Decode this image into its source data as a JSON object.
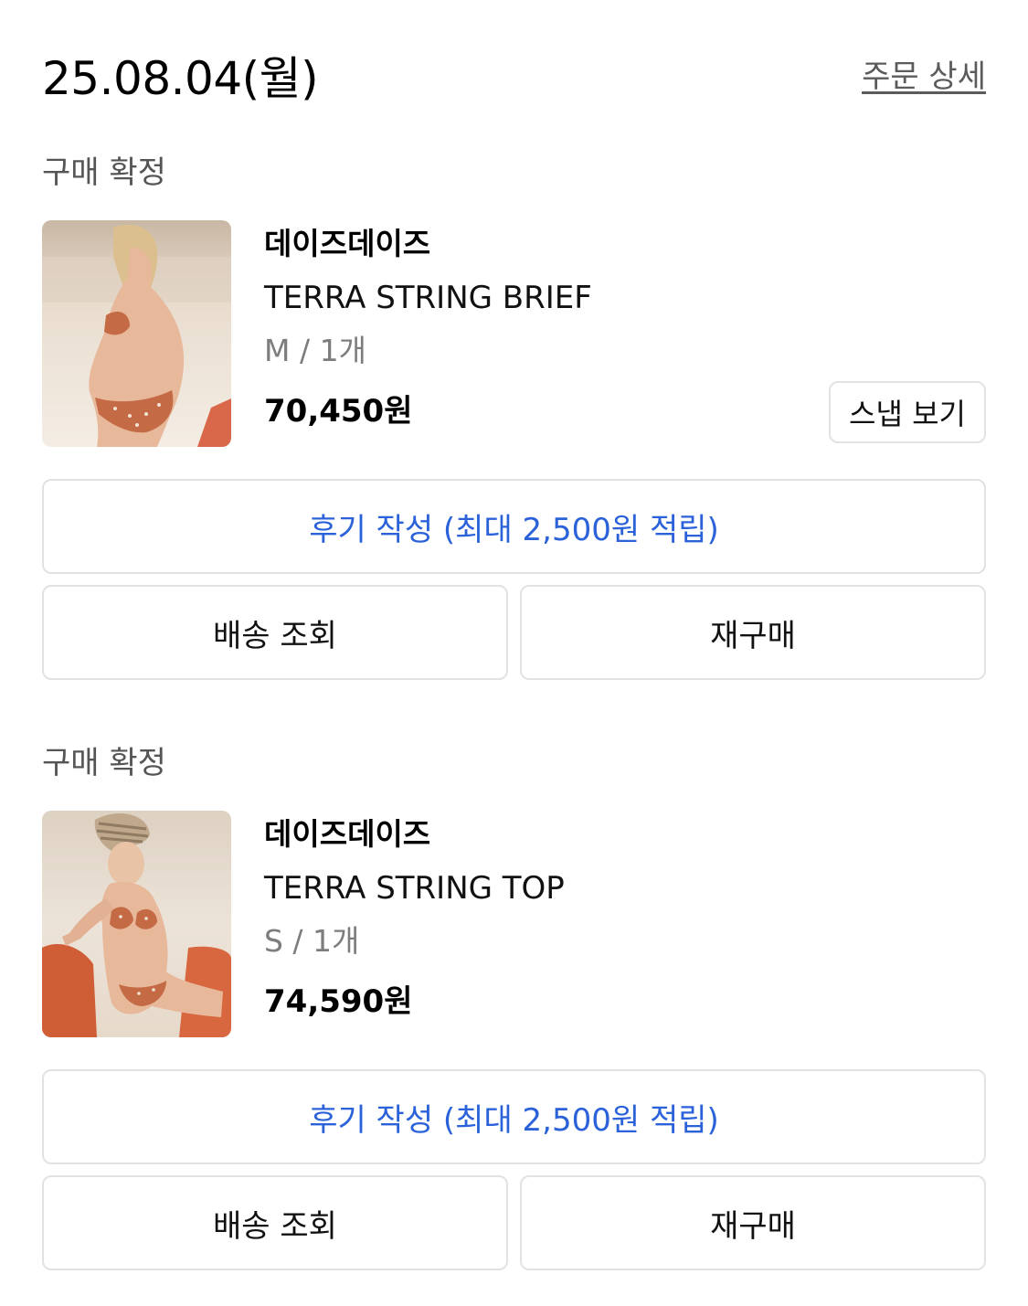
{
  "header": {
    "order_date": "25.08.04(월)",
    "order_detail_label": "주문 상세"
  },
  "orders": [
    {
      "status": "구매 확정",
      "image_icon": "product-photo-bikini-brief",
      "brand": "데이즈데이즈",
      "product_name": "TERRA STRING BRIEF",
      "option": "M / 1개",
      "price": "70,450원",
      "snap_label": "스냅 보기",
      "review_label": "후기 작성 (최대 2,500원 적립)",
      "track_label": "배송 조회",
      "rebuy_label": "재구매"
    },
    {
      "status": "구매 확정",
      "image_icon": "product-photo-bikini-top",
      "brand": "데이즈데이즈",
      "product_name": "TERRA STRING TOP",
      "option": "S / 1개",
      "price": "74,590원",
      "review_label": "후기 작성 (최대 2,500원 적립)",
      "track_label": "배송 조회",
      "rebuy_label": "재구매"
    }
  ],
  "colors": {
    "accent_link": "#2b62d9",
    "muted_text": "#7d7d7d",
    "border": "#e2e2e2"
  }
}
